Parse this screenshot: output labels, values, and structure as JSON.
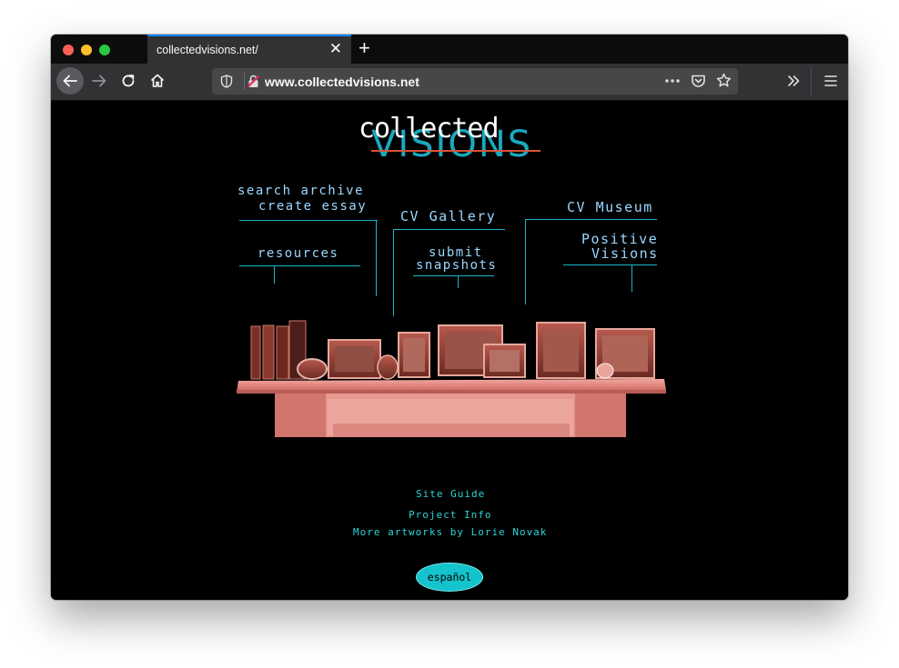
{
  "browser": {
    "tab_title": "collectedvisions.net/",
    "url": "www.collectedvisions.net",
    "new_tab_symbol": "+",
    "close_symbol": "✕"
  },
  "site": {
    "logo_top": "collected",
    "logo_bottom": "VISIONS",
    "nav": {
      "search_archive": "search archive",
      "create_essay": "create essay",
      "resources": "resources",
      "cv_gallery": "CV Gallery",
      "submit_line1": "submit",
      "submit_line2": "snapshots",
      "cv_museum": "CV Museum",
      "positive_line1": "Positive",
      "positive_line2": "Visions"
    },
    "footer": {
      "site_guide": "Site Guide",
      "project_info": "Project Info",
      "more_artworks": "More artworks by Lorie Novak"
    },
    "espanol": "español"
  },
  "colors": {
    "accent_teal": "#18b6c8",
    "nav_text": "#9ad7ff",
    "mantel_pink": "#e8928a"
  }
}
